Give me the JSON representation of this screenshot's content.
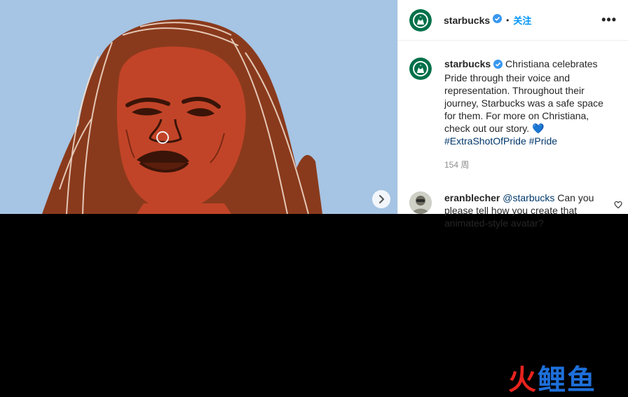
{
  "header": {
    "username": "starbucks",
    "separator": "•",
    "follow_label": "关注",
    "more_label": "•••"
  },
  "caption": {
    "username": "starbucks",
    "text": " Christiana celebrates Pride through their voice and representation. Throughout their journey, Starbucks was a safe space for them. For more on Christiana, check out our story. 💙 ",
    "hashtags": [
      "#ExtraShotOfPride",
      "#Pride"
    ],
    "time": "154 周"
  },
  "comment": {
    "username": "eranblecher",
    "mention": "@starbucks",
    "text": " Can you please tell how you create that animated-style avatar?"
  },
  "watermark": {
    "chars": [
      "火",
      "鲤",
      "鱼"
    ]
  },
  "colors": {
    "image_background": "#a6c4e3",
    "face": "#c24428",
    "hair": "#8a3a1c",
    "starbucks_green": "#00704a",
    "link_blue": "#0095f6",
    "hashtag": "#00376b",
    "watermark_red": "#e8231e",
    "watermark_blue": "#1e6fd9"
  },
  "icons": [
    "chevron-right-icon",
    "verified-badge-icon",
    "more-options-icon",
    "heart-icon",
    "starbucks-logo-icon"
  ]
}
